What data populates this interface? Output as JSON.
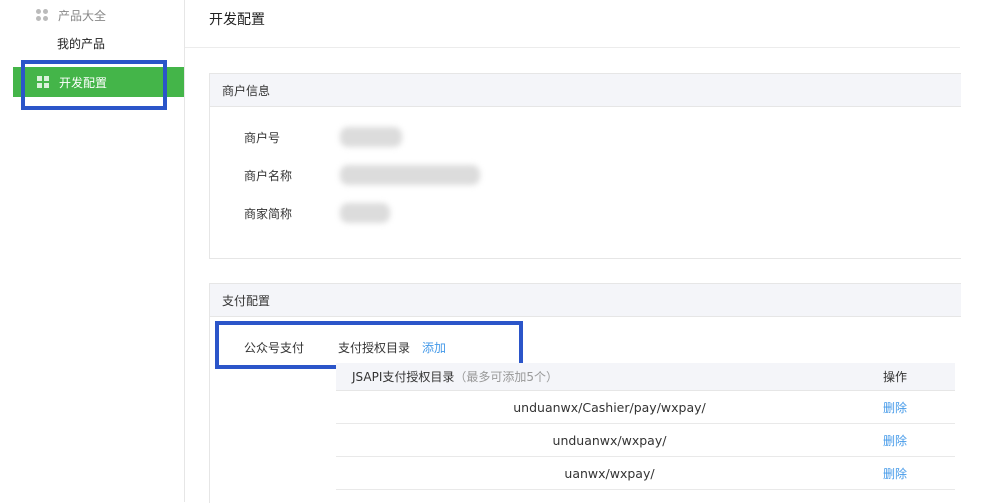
{
  "sidebar": {
    "group_label": "产品大全",
    "sub_item": "我的产品",
    "active_item": "开发配置"
  },
  "page_title": "开发配置",
  "merchant_info": {
    "title": "商户信息",
    "rows": [
      {
        "label": "商户号"
      },
      {
        "label": "商户名称"
      },
      {
        "label": "商家简称"
      }
    ]
  },
  "payment_config": {
    "title": "支付配置",
    "method_label": "公众号支付",
    "dir_label": "支付授权目录",
    "add_link": "添加",
    "table": {
      "header_main": "JSAPI支付授权目录",
      "header_note": "（最多可添加5个）",
      "header_op": "操作",
      "rows": [
        {
          "path": "unduanwx/Cashier/pay/wxpay/",
          "op": "删除"
        },
        {
          "path": "unduanwx/wxpay/",
          "op": "删除"
        },
        {
          "path": "uanwx/wxpay/",
          "op": "删除"
        }
      ]
    }
  },
  "colors": {
    "active_green": "#44b549",
    "highlight_blue": "#2b55c9",
    "link_blue": "#459ae9"
  }
}
